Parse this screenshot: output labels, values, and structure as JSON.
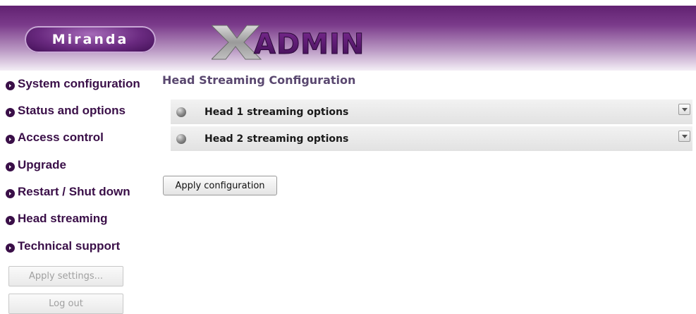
{
  "header": {
    "brand_logo_text": "Miranda",
    "product_logo_text": "XADMIN"
  },
  "sidebar": {
    "items": [
      {
        "label": "System configuration"
      },
      {
        "label": "Status and options"
      },
      {
        "label": "Access control"
      },
      {
        "label": "Upgrade"
      },
      {
        "label": "Restart / Shut down"
      },
      {
        "label": "Head streaming"
      },
      {
        "label": "Technical support"
      }
    ],
    "apply_settings_label": "Apply settings...",
    "logout_label": "Log out"
  },
  "main": {
    "title": "Head Streaming Configuration",
    "sections": [
      {
        "label": "Head 1 streaming options"
      },
      {
        "label": "Head 2 streaming options"
      }
    ],
    "apply_label": "Apply configuration"
  },
  "colors": {
    "brand_purple": "#3a0f48",
    "header_purple": "#5a1a6a",
    "title_color": "#5a4870"
  }
}
